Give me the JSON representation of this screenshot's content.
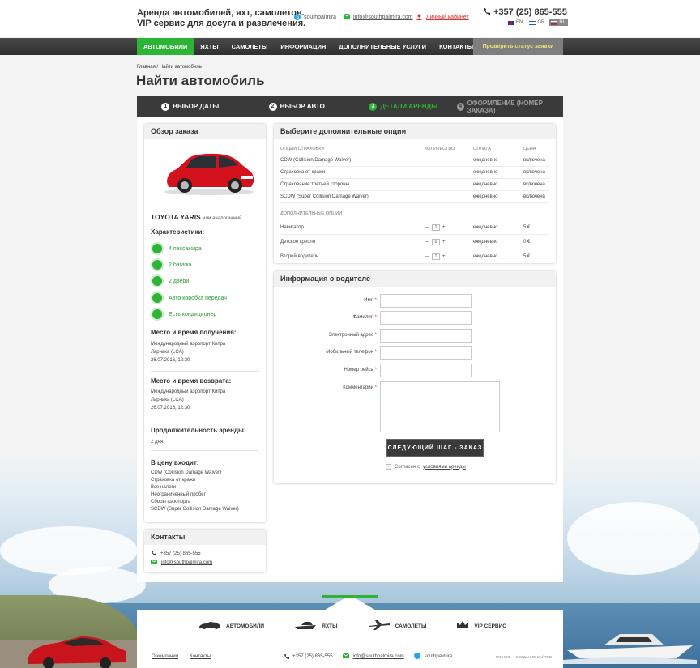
{
  "header": {
    "tagline_line1": "Аренда автомобилей, яхт, самолетов.",
    "tagline_line2": "VIP сервис для досуга и развлечения.",
    "skype": "southpalmira",
    "email": "info@southpalmira.com",
    "cabinet": "Личный кабинет",
    "phone": "+357 (25) 865-555",
    "langs": [
      "EN",
      "GR",
      "RU"
    ]
  },
  "nav": {
    "items": [
      "Автомобили",
      "Яхты",
      "Самолеты",
      "Информация",
      "Дополнительные услуги",
      "Контакты"
    ],
    "status_button": "Проверить статус заявки"
  },
  "breadcrumb": "Главная / Найти автомобиль",
  "page_title": "Найти автомобиль",
  "steps": [
    {
      "num": "1",
      "label": "Выбор даты"
    },
    {
      "num": "2",
      "label": "Выбор авто"
    },
    {
      "num": "3",
      "label": "Детали аренды"
    },
    {
      "num": "4",
      "label": "Оформление (номер заказа)"
    }
  ],
  "summary": {
    "title": "Обзор заказа",
    "car_name": "TOYOTA YARIS",
    "car_sub": "или аналогичный",
    "features_title": "Характеристики:",
    "features": [
      "4 пассажира",
      "2 багажа",
      "2 двери",
      "Авто коробка передач",
      "Есть кондиционер"
    ],
    "pickup_title": "Место и время получения:",
    "pickup_place": "Международный аэропорт Кипра",
    "pickup_city": "Ларнака (LCA)",
    "pickup_date": "26.07.2016, 12:30",
    "return_title": "Место и время возврата:",
    "return_place": "Международный аэропорт Кипра",
    "return_city": "Ларнака (LCA)",
    "return_date": "26.07.2016, 12:30",
    "duration_title": "Продолжительность аренды:",
    "duration": "2 дня",
    "included_title": "В цену входит:",
    "included": [
      "CDW (Collision Damage Waiver)",
      "Страховка от кражи",
      "Все налоги",
      "Неограниченный пробег",
      "Сборы аэропорта",
      "SCDW (Super Collision Damage Waiver)"
    ]
  },
  "options": {
    "title": "Выберите дополнительные опции",
    "headers": [
      "Опции страховки",
      "Количество",
      "Оплата",
      "Цена"
    ],
    "insurance": [
      {
        "name": "CDW (Collision Damage Waiver)",
        "pay": "ежедневно",
        "price": "включена"
      },
      {
        "name": "Страховка от кражи",
        "pay": "ежедневно",
        "price": "включена"
      },
      {
        "name": "Страхование третьей стороны",
        "pay": "ежедневно",
        "price": "включена"
      },
      {
        "name": "SCDW (Super Collision Damage Waiver)",
        "pay": "ежедневно",
        "price": "включена"
      }
    ],
    "extra_header": "Дополнительные опции",
    "extras": [
      {
        "name": "Навигатор",
        "qty": "1",
        "pay": "ежедневно",
        "price": "5 €"
      },
      {
        "name": "Детское кресло",
        "qty": "0",
        "pay": "ежедневно",
        "price": "0 €"
      },
      {
        "name": "Второй водитель",
        "qty": "1",
        "pay": "ежедневно",
        "price": "5 €"
      }
    ]
  },
  "driver": {
    "title": "Информация о водителе",
    "fields": [
      "Имя",
      "Фамилия",
      "Электронный адрес",
      "Мобильный телефон",
      "Номер рейса",
      "Комментарий"
    ],
    "next_button": "Следующий шаг - заказ",
    "agree_text": "Согласен с",
    "agree_link": "условиями аренды"
  },
  "contacts": {
    "title": "Контакты",
    "phone": "+357 (25) 865-555",
    "email": "info@southpalmira.com"
  },
  "footer": {
    "categories": [
      "Автомобили",
      "Яхты",
      "Самолеты",
      "VIP сервис"
    ],
    "about": "О компании",
    "contacts": "Контакты",
    "phone": "+357 (25) 865-555",
    "email": "info@southpalmira.com",
    "skype": "southpalmira",
    "credit": "ГЛИНОЗ — СОЗДАНИЕ САЙТОВ"
  },
  "colors": {
    "accent": "#2db335",
    "dark": "#3a3a3a",
    "status_text": "#f0e37a"
  }
}
